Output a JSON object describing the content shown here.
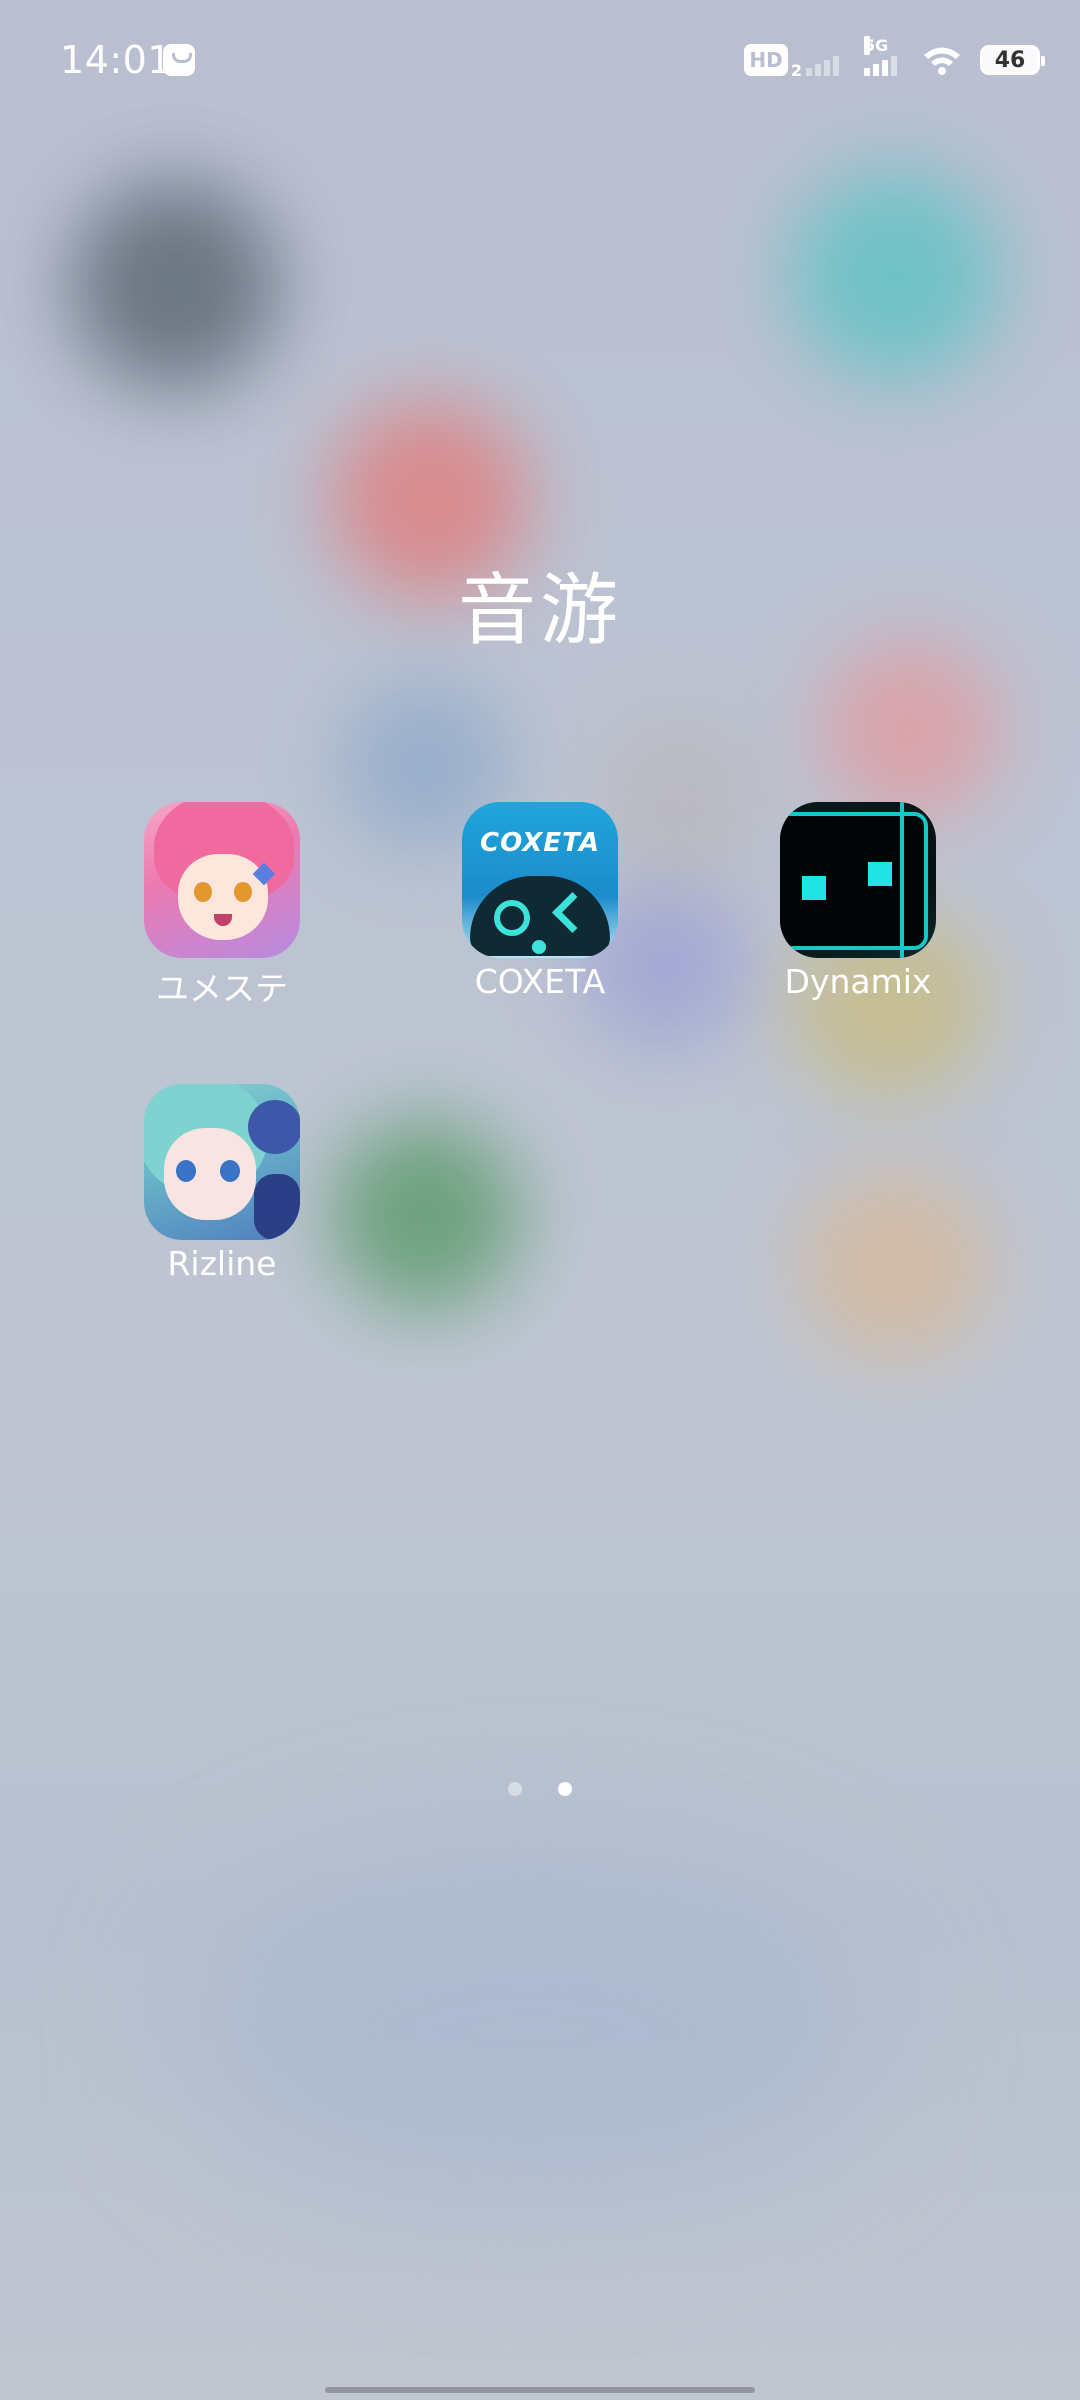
{
  "status_bar": {
    "time": "14:01",
    "hd_label": "HD",
    "hd_sub": "2",
    "network_label": "5G",
    "battery_level": "46"
  },
  "folder": {
    "title": "音游",
    "apps": [
      {
        "label": "ユメステ",
        "icon": "yumesute-app-icon"
      },
      {
        "label": "COXETA",
        "icon": "coxeta-app-icon"
      },
      {
        "label": "Dynamix",
        "icon": "dynamix-app-icon"
      },
      {
        "label": "Rizline",
        "icon": "rizline-app-icon"
      }
    ],
    "coxeta_logo_text": "COXETA"
  },
  "page_indicator": {
    "pages": 2,
    "current_page": 2
  }
}
